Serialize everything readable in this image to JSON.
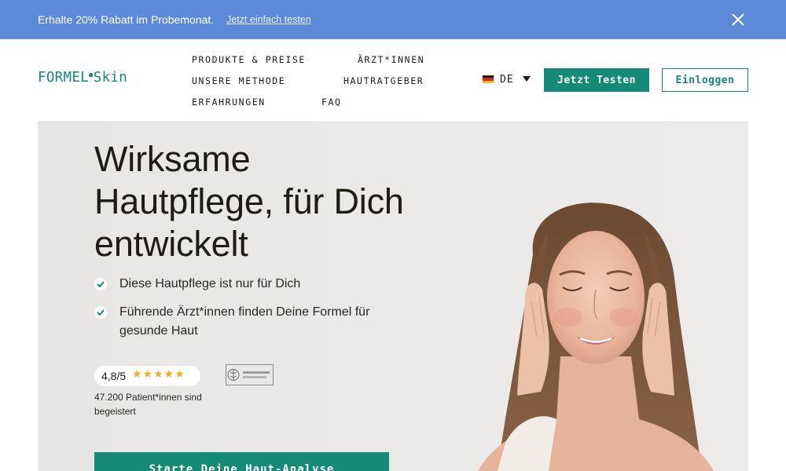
{
  "promo": {
    "text": "Erhalte 20% Rabatt im Probemonat.",
    "link": "Jetzt einfach testen",
    "close_icon": "close-icon"
  },
  "header": {
    "logo": {
      "main": "FORMEL",
      "dot": "●",
      "sub": "Skin"
    },
    "nav": [
      {
        "label": "PRODUKTE & PREISE"
      },
      {
        "label": "ÄRZT*INNEN"
      },
      {
        "label": "UNSERE METHODE"
      },
      {
        "label": "HAUTRATGEBER"
      },
      {
        "label": "ERFAHRUNGEN"
      },
      {
        "label": "FAQ"
      }
    ],
    "language": {
      "label": "DE",
      "flag_icon": "german-flag-icon"
    },
    "primary_button": "Jetzt Testen",
    "login_button": "Einloggen"
  },
  "hero": {
    "title": "Wirksame Hautpflege, für Dich entwickelt",
    "checks": [
      {
        "text": "Diese Hautpflege ist nur für Dich"
      },
      {
        "text": "Führende Ärzt*innen finden Deine Formel für gesunde Haut"
      }
    ],
    "rating": {
      "score": "4,8/5",
      "stars": "★★★★★",
      "stars_value": 5,
      "caption": "47.200 Patient*innen sind begeistert"
    },
    "badge_icon": "doctor-association-badge-icon",
    "cta": "Starte Deine Haut-Analyse"
  },
  "colors": {
    "promo_bg": "#5d8ad8",
    "brand": "#148a77",
    "hero_bg": "#e9e8e6",
    "star": "#f2b01e"
  }
}
